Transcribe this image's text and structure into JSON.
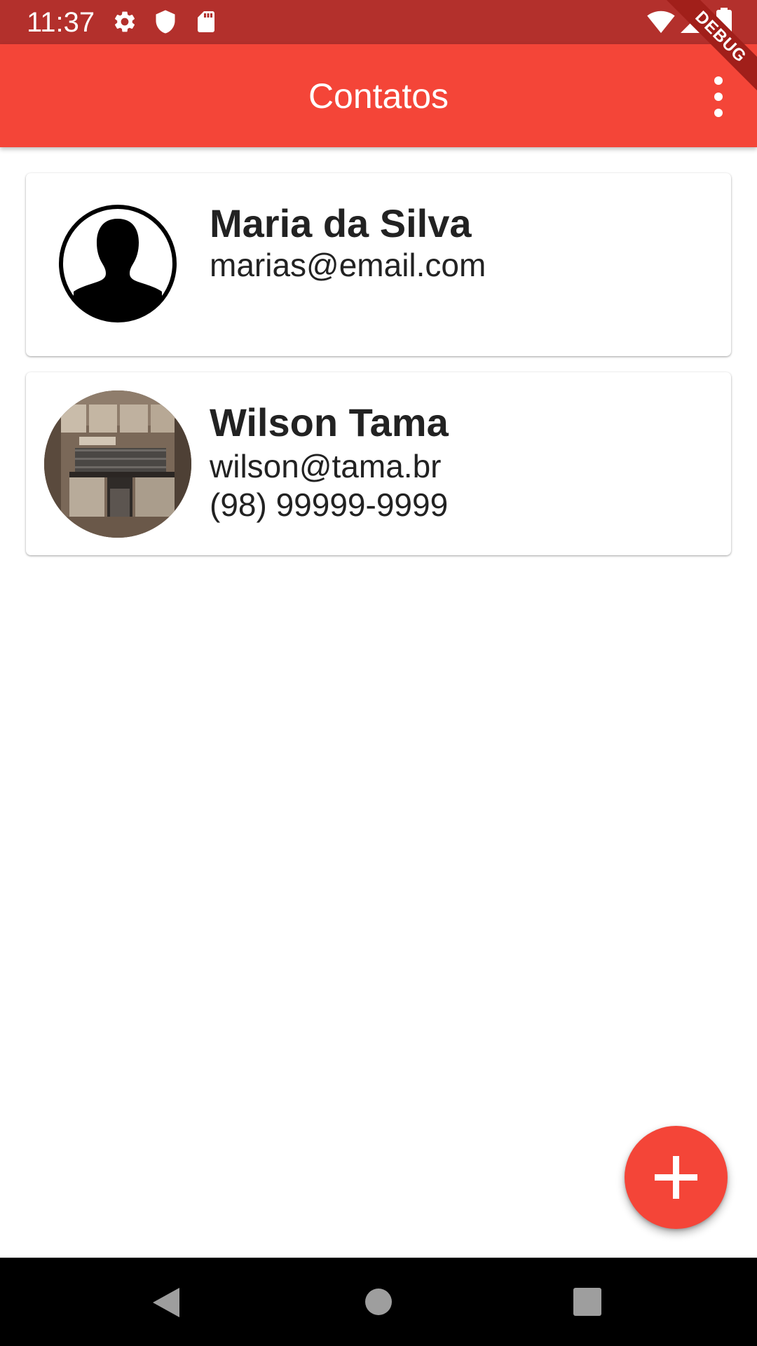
{
  "status_bar": {
    "time": "11:37",
    "icons": [
      "settings-icon",
      "shield-icon",
      "sd-card-icon",
      "wifi-icon",
      "signal-icon",
      "battery-icon"
    ],
    "background": "#b3302c"
  },
  "app_bar": {
    "title": "Contatos",
    "menu_icon": "more-vert-icon",
    "background": "#f44538",
    "debug_banner": "DEBUG"
  },
  "contacts": [
    {
      "name": "Maria da Silva",
      "email": "marias@email.com",
      "phone": "",
      "avatar": "person-placeholder-icon"
    },
    {
      "name": "Wilson Tama",
      "email": "wilson@tama.br",
      "phone": "(98) 99999-9999",
      "avatar": "kitchen-photo"
    }
  ],
  "fab": {
    "icon": "add-icon",
    "color": "#f44538"
  },
  "nav_bar": {
    "icons": [
      "back-icon",
      "home-icon",
      "recents-icon"
    ]
  }
}
